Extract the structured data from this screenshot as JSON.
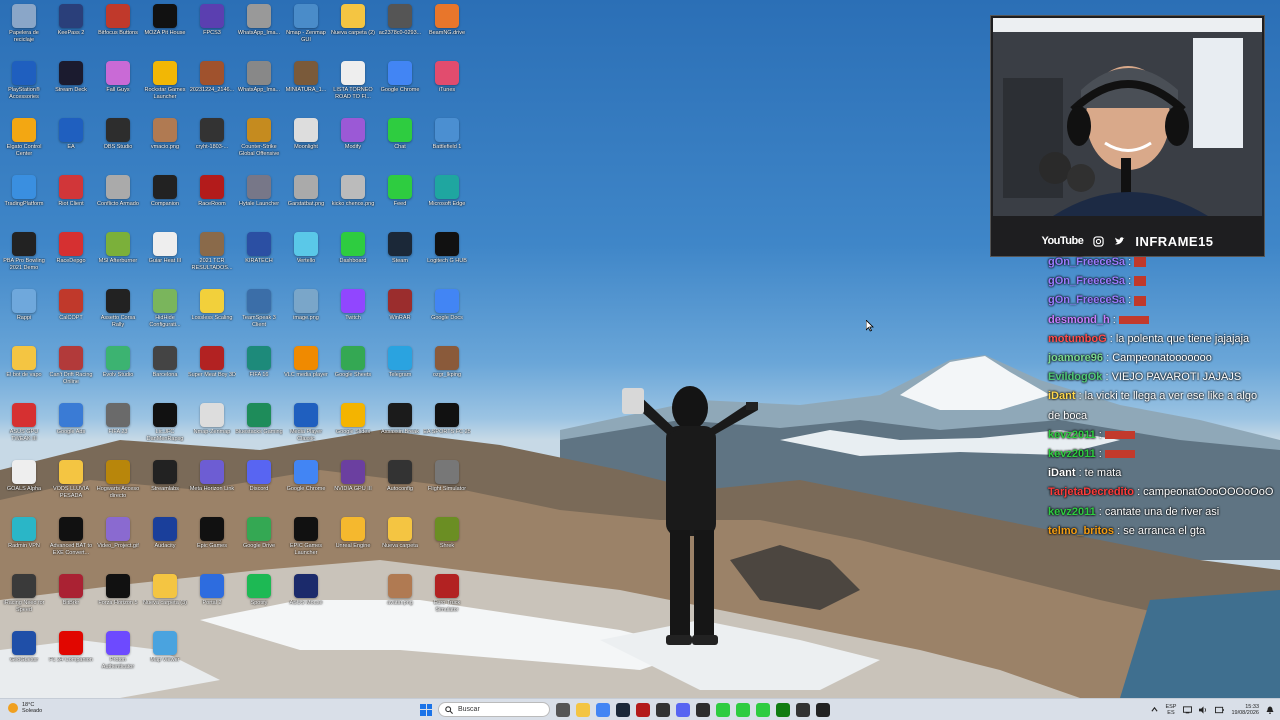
{
  "desktop": {
    "icons": [
      {
        "label": "Papelera de reciclaje",
        "icon": "recycle-bin-icon",
        "color": "#8aa6c8"
      },
      {
        "label": "KeePass 2",
        "icon": "keepass-icon",
        "color": "#2a3f7a"
      },
      {
        "label": "Bitfocus Buttons",
        "icon": "bitfocus-icon",
        "color": "#c0392b"
      },
      {
        "label": "MOZA Pit House",
        "icon": "moza-icon",
        "color": "#111111"
      },
      {
        "label": "FPCS3",
        "icon": "fpcs-icon",
        "color": "#5b3fb0"
      },
      {
        "label": "WhatsApp_Ima...",
        "icon": "image-file-icon",
        "color": "#999999"
      },
      {
        "label": "Nmap - Zenmap GUI",
        "icon": "nmap-icon",
        "color": "#4a8cc9"
      },
      {
        "label": "Nueva carpeta (2)",
        "icon": "folder-icon",
        "color": "#f4c542"
      },
      {
        "label": "ac2378c0-0293...",
        "icon": "image-file-icon",
        "color": "#555555"
      },
      {
        "label": "BeamNG.drive",
        "icon": "beamng-icon",
        "color": "#e8762b"
      },
      {
        "label": "PlayStation® Accessories",
        "icon": "playstation-icon",
        "color": "#1f5fbf"
      },
      {
        "label": "Stream Deck",
        "icon": "stream-deck-icon",
        "color": "#1b1b2f"
      },
      {
        "label": "Fall Guys",
        "icon": "fall-guys-icon",
        "color": "#c96ad6"
      },
      {
        "label": "Rockstar Games Launcher",
        "icon": "rockstar-icon",
        "color": "#f2b705"
      },
      {
        "label": "20231224_2146...",
        "icon": "image-file-icon",
        "color": "#a0522d"
      },
      {
        "label": "WhatsApp_Ima...",
        "icon": "image-file-icon",
        "color": "#888888"
      },
      {
        "label": "MINIATURA_1...",
        "icon": "image-file-icon",
        "color": "#7a5a3a"
      },
      {
        "label": "LISTA TORNEO ROAD TO FI...",
        "icon": "document-icon",
        "color": "#eeeeee"
      },
      {
        "label": "Google Chrome",
        "icon": "chrome-icon",
        "color": "#4285f4"
      },
      {
        "label": "iTunes",
        "icon": "itunes-icon",
        "color": "#e24c6e"
      },
      {
        "label": "Elgato Control Center",
        "icon": "elgato-icon",
        "color": "#f3a712"
      },
      {
        "label": "EA",
        "icon": "ea-icon",
        "color": "#1f5fbf"
      },
      {
        "label": "OBS Studio",
        "icon": "obs-icon",
        "color": "#2d2d2d"
      },
      {
        "label": "vmacio.png",
        "icon": "image-file-icon",
        "color": "#b07a52"
      },
      {
        "label": "cryht-1803-...",
        "icon": "image-file-icon",
        "color": "#333333"
      },
      {
        "label": "Counter-Strike Global Offensive",
        "icon": "csgo-icon",
        "color": "#c58b1f"
      },
      {
        "label": "Moonlight",
        "icon": "moonlight-icon",
        "color": "#dddddd"
      },
      {
        "label": "Modify",
        "icon": "modify-icon",
        "color": "#9b59d6"
      },
      {
        "label": "Chat",
        "icon": "kick-icon",
        "color": "#2ecc40"
      },
      {
        "label": "Battlefield 1",
        "icon": "battlefield-icon",
        "color": "#4b8fd1"
      },
      {
        "label": "TradingPlatform",
        "icon": "trading-icon",
        "color": "#3a8fe0"
      },
      {
        "label": "Riot Client",
        "icon": "riot-icon",
        "color": "#d13639"
      },
      {
        "label": "Conflicto Armado",
        "icon": "image-file-icon",
        "color": "#aaaaaa"
      },
      {
        "label": "Companion",
        "icon": "companion-icon",
        "color": "#222222"
      },
      {
        "label": "RaceRoom",
        "icon": "raceroom-icon",
        "color": "#b31b1b"
      },
      {
        "label": "Hytale Launcher",
        "icon": "hytale-icon",
        "color": "#777788"
      },
      {
        "label": "Garstatbat.png",
        "icon": "image-file-icon",
        "color": "#aaaaaa"
      },
      {
        "label": "kicko chenos.png",
        "icon": "image-file-icon",
        "color": "#bbbbbb"
      },
      {
        "label": "Feed",
        "icon": "kick-icon",
        "color": "#2ecc40"
      },
      {
        "label": "Microsoft Edge",
        "icon": "edge-icon",
        "color": "#1fa6a0"
      },
      {
        "label": "PBA Pro Bowling 2021 Demo",
        "icon": "pba-icon",
        "color": "#222222"
      },
      {
        "label": "RaceDepgo",
        "icon": "racedepgo-icon",
        "color": "#d63031"
      },
      {
        "label": "MSI Afterburner",
        "icon": "afterburner-icon",
        "color": "#7bb03a"
      },
      {
        "label": "Guiar Heat III",
        "icon": "document-icon",
        "color": "#eeeeee"
      },
      {
        "label": "2021 TCR RESULTADOS...",
        "icon": "image-file-icon",
        "color": "#8a6a4a"
      },
      {
        "label": "KIRATECH",
        "icon": "kiratech-icon",
        "color": "#2b4fa3"
      },
      {
        "label": "Vertello",
        "icon": "vertello-icon",
        "color": "#5ac8e8"
      },
      {
        "label": "Dashboard",
        "icon": "kick-icon",
        "color": "#2ecc40"
      },
      {
        "label": "Steam",
        "icon": "steam-icon",
        "color": "#1b2838"
      },
      {
        "label": "Logitech G HUB",
        "icon": "ghub-icon",
        "color": "#111111"
      },
      {
        "label": "Rappi",
        "icon": "rappi-icon",
        "color": "#6fa8dc"
      },
      {
        "label": "CalCOPT",
        "icon": "image-file-icon",
        "color": "#c0392b"
      },
      {
        "label": "Assetto Corsa Rally",
        "icon": "acrally-icon",
        "color": "#222222"
      },
      {
        "label": "HidHide Configurati...",
        "icon": "hidhide-icon",
        "color": "#7ab55c"
      },
      {
        "label": "Lossless Scaling",
        "icon": "lossless-icon",
        "color": "#f2d03b"
      },
      {
        "label": "TeamSpeak 3 Client",
        "icon": "teamspeak-icon",
        "color": "#3b6ea8"
      },
      {
        "label": "image.png",
        "icon": "image-file-icon",
        "color": "#7aa6c9"
      },
      {
        "label": "Twitch",
        "icon": "twitch-icon",
        "color": "#9146ff"
      },
      {
        "label": "WinRAR",
        "icon": "winrar-icon",
        "color": "#9b2d2d"
      },
      {
        "label": "Google Docs",
        "icon": "google-docs-icon",
        "color": "#4285f4"
      },
      {
        "label": "El bot de vapo",
        "icon": "folder-icon",
        "color": "#f4c542"
      },
      {
        "label": "Can't Drift Racing Online",
        "icon": "drift-icon",
        "color": "#b23a3a"
      },
      {
        "label": "Evolv Studio",
        "icon": "evolv-icon",
        "color": "#3cb371"
      },
      {
        "label": "Barcelona",
        "icon": "image-file-icon",
        "color": "#444444"
      },
      {
        "label": "Super Meat Boy 3D",
        "icon": "meatboy-icon",
        "color": "#b22222"
      },
      {
        "label": "FIFA 16",
        "icon": "fifa-icon",
        "color": "#1d8a7a"
      },
      {
        "label": "VLC media player",
        "icon": "vlc-icon",
        "color": "#f08a00"
      },
      {
        "label": "Google Sheets",
        "icon": "google-sheets-icon",
        "color": "#34a853"
      },
      {
        "label": "Telegram",
        "icon": "telegram-icon",
        "color": "#2aa3e0"
      },
      {
        "label": "ozgr_lkping",
        "icon": "image-file-icon",
        "color": "#8a5a3a"
      },
      {
        "label": "ASUS GPU TWEAK III",
        "icon": "asus-icon",
        "color": "#d63031"
      },
      {
        "label": "Google Ads",
        "icon": "document-icon",
        "color": "#3a7bd5"
      },
      {
        "label": "FIFA 23",
        "icon": "image-file-icon",
        "color": "#6a6a6a"
      },
      {
        "label": "Lic.JFC DanMenRapsg",
        "icon": "image-file-icon",
        "color": "#111111"
      },
      {
        "label": "Nmap-Zenmap",
        "icon": "document-icon",
        "color": "#dddddd"
      },
      {
        "label": "Bluestacks Gaming",
        "icon": "bluestacks-icon",
        "color": "#1e8c5a"
      },
      {
        "label": "Media Player Classic",
        "icon": "mpc-icon",
        "color": "#1f5fbf"
      },
      {
        "label": "Google Slides",
        "icon": "google-slides-icon",
        "color": "#f4b400"
      },
      {
        "label": "Assassin Break",
        "icon": "image-file-icon",
        "color": "#1b1b1b"
      },
      {
        "label": "EA SPORTS FC 25",
        "icon": "fc25-icon",
        "color": "#111111"
      },
      {
        "label": "GOALS Alpha",
        "icon": "goals-icon",
        "color": "#eeeeee"
      },
      {
        "label": "VODS LLUVIA PESADA",
        "icon": "folder-icon",
        "color": "#f4c542"
      },
      {
        "label": "Hogwarts Acceso directo",
        "icon": "hogwarts-icon",
        "color": "#b8860b"
      },
      {
        "label": "Streamlabs",
        "icon": "streamlabs-icon",
        "color": "#222222"
      },
      {
        "label": "Meta Horizon Link",
        "icon": "meta-icon",
        "color": "#6d5dd3"
      },
      {
        "label": "Discord",
        "icon": "discord-icon",
        "color": "#5865f2"
      },
      {
        "label": "Google Chrome",
        "icon": "chrome-icon",
        "color": "#4285f4"
      },
      {
        "label": "NVIDIA GPU III",
        "icon": "nvidia-icon",
        "color": "#6b3fa0"
      },
      {
        "label": "Autoconfig",
        "icon": "image-file-icon",
        "color": "#333333"
      },
      {
        "label": "Flight Simulator",
        "icon": "image-file-icon",
        "color": "#777777"
      },
      {
        "label": "Radmin VPN",
        "icon": "radmin-icon",
        "color": "#2ab6c7"
      },
      {
        "label": "Advanced BAT to EXE Convert...",
        "icon": "bat-exe-icon",
        "color": "#111111"
      },
      {
        "label": "Video_Project.gif",
        "icon": "image-file-icon",
        "color": "#8a6ad0"
      },
      {
        "label": "Audacity",
        "icon": "audacity-icon",
        "color": "#1a3f9b"
      },
      {
        "label": "Epic Games",
        "icon": "epic-games-icon",
        "color": "#111111"
      },
      {
        "label": "Google Drive",
        "icon": "google-drive-icon",
        "color": "#34a853"
      },
      {
        "label": "EPIC Games Launcher",
        "icon": "epic-games-icon",
        "color": "#111111"
      },
      {
        "label": "Unreal Engine",
        "icon": "unreal-icon",
        "color": "#f5b82e"
      },
      {
        "label": "Nueva carpeta",
        "icon": "folder-icon",
        "color": "#f4c542"
      },
      {
        "label": "Shrek",
        "icon": "image-file-icon",
        "color": "#6b8e23"
      },
      {
        "label": "iRacing Need for Speed",
        "icon": "image-file-icon",
        "color": "#3a3a3a"
      },
      {
        "label": "BitBrkr",
        "icon": "image-file-icon",
        "color": "#aa2233"
      },
      {
        "label": "Forza Horizon 5",
        "icon": "forza-icon",
        "color": "#111111"
      },
      {
        "label": "Nueva carpeta (3)",
        "icon": "folder-icon",
        "color": "#f4c542"
      },
      {
        "label": "Portal 2",
        "icon": "portal-icon",
        "color": "#2d6cdf"
      },
      {
        "label": "Spotify",
        "icon": "spotify-icon",
        "color": "#1db954"
      },
      {
        "label": "ASUS Mouse",
        "icon": "asus-mouse-icon",
        "color": "#1b2a6b"
      },
      {
        "label": "",
        "icon": "empty",
        "color": "transparent"
      },
      {
        "label": "avatar.png",
        "icon": "image-file-icon",
        "color": "#b07a52"
      },
      {
        "label": "Euro Truck Simulator",
        "icon": "ets-icon",
        "color": "#b22222"
      },
      {
        "label": "GeoGuessr",
        "icon": "geoguessr-icon",
        "color": "#1f4fa8"
      },
      {
        "label": "F1 24 Companion",
        "icon": "f1-icon",
        "color": "#e10600"
      },
      {
        "label": "Proton Authenticator",
        "icon": "proton-icon",
        "color": "#6d4aff"
      },
      {
        "label": "Map Viewer",
        "icon": "mapviewer-icon",
        "color": "#4aa3df"
      }
    ]
  },
  "webcam": {
    "platform": "YouTube",
    "channel": "INFRAME15"
  },
  "chat": {
    "messages": [
      {
        "user": "gOn_FreeceSa",
        "text": ":",
        "emote": "small",
        "color": "#9b7bff"
      },
      {
        "user": "gOn_FreeceSa",
        "text": ":",
        "emote": "small",
        "color": "#9b7bff"
      },
      {
        "user": "gOn_FreeceSa",
        "text": ":",
        "emote": "small",
        "color": "#9b7bff"
      },
      {
        "user": "desmond_h",
        "text": ":",
        "emote": "wide",
        "color": "#c77dff"
      },
      {
        "user": "motumboG",
        "text": ": la polenta que tiene jajajaja",
        "emote": "",
        "color": "#ff4d4d"
      },
      {
        "user": "joamore96",
        "text": ": Campeonatooooooo",
        "emote": "",
        "color": "#7bd88f"
      },
      {
        "user": "EvildogOk",
        "text": ": VIEJO PAVAROTI JAJAJS",
        "emote": "",
        "color": "#50c878"
      },
      {
        "user": "iDant",
        "text": ": la vicki te llega a ver ese like a algo de boca",
        "emote": "",
        "color": "#ffd84d"
      },
      {
        "user": "kevz2011",
        "text": ":",
        "emote": "wide",
        "color": "#2ecc40"
      },
      {
        "user": "kevz2011",
        "text": ":",
        "emote": "wide",
        "color": "#2ecc40"
      },
      {
        "user": "iDant",
        "text": ": te mata",
        "emote": "",
        "color": "#ffffff"
      },
      {
        "user": "TarjetaDecredito",
        "text": ": campeonatOooOOOoOoO",
        "emote": "",
        "color": "#ff3b3b"
      },
      {
        "user": "kevz2011",
        "text": ": cantate una de river asi",
        "emote": "",
        "color": "#2ecc40"
      },
      {
        "user": "telmo_britos",
        "text": ": se arranca el gta",
        "emote": "",
        "color": "#f39c12"
      }
    ]
  },
  "taskbar": {
    "weather_temp": "18°C",
    "weather_desc": "Soleado",
    "search_placeholder": "Buscar",
    "lang_top": "ESP",
    "lang_bottom": "ES",
    "time": "15:33",
    "date": "19/08/2026",
    "apps": [
      {
        "icon": "task-view-icon",
        "color": "#555555"
      },
      {
        "icon": "file-explorer-icon",
        "color": "#f4c542"
      },
      {
        "icon": "chrome-icon",
        "color": "#4285f4"
      },
      {
        "icon": "steam-icon",
        "color": "#1b2838"
      },
      {
        "icon": "raceroom-icon",
        "color": "#b31b1b"
      },
      {
        "icon": "ghub-icon",
        "color": "#333333"
      },
      {
        "icon": "discord-icon",
        "color": "#5865f2"
      },
      {
        "icon": "obs-icon",
        "color": "#2d2d2d"
      },
      {
        "icon": "kick-icon",
        "color": "#2ecc40"
      },
      {
        "icon": "kick-icon",
        "color": "#2ecc40"
      },
      {
        "icon": "kick-icon",
        "color": "#2ecc40"
      },
      {
        "icon": "xbox-icon",
        "color": "#107c10"
      },
      {
        "icon": "terminal-icon",
        "color": "#333333"
      },
      {
        "icon": "app-icon",
        "color": "#222222"
      }
    ]
  }
}
